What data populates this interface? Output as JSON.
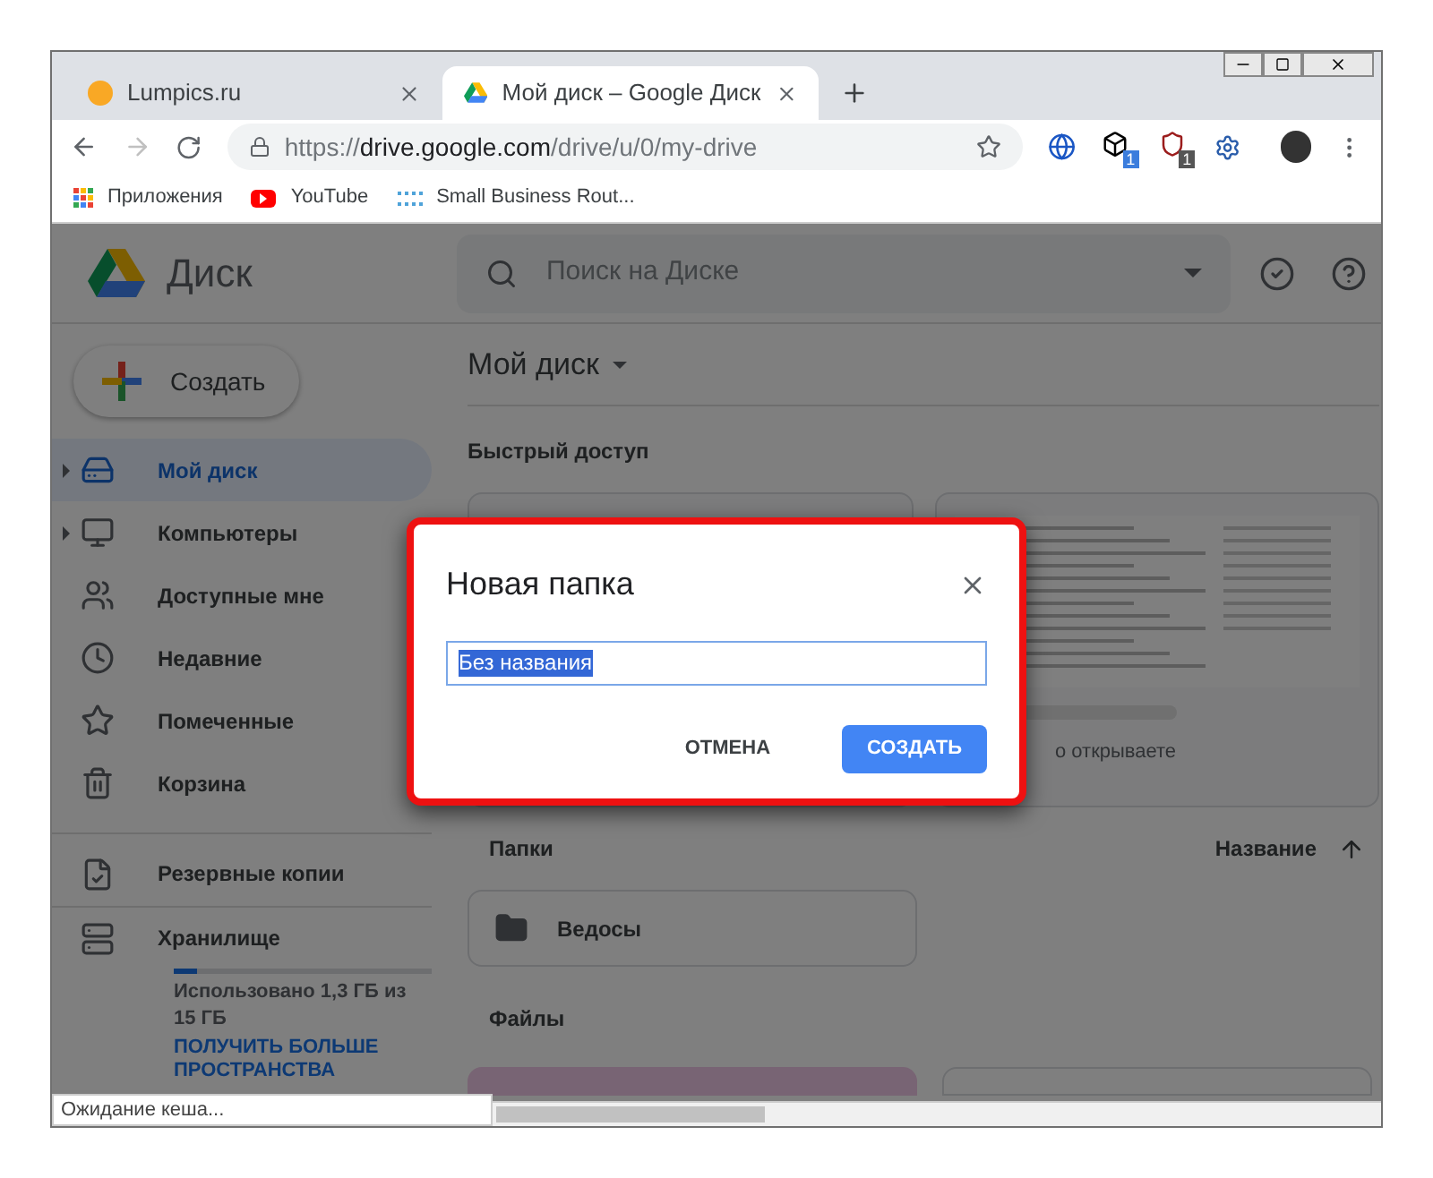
{
  "browser": {
    "tabs": [
      {
        "title": "Lumpics.ru",
        "selected": false
      },
      {
        "title": "Мой диск – Google Диск",
        "selected": true
      }
    ],
    "address": {
      "scheme": "https://",
      "host": "drive.google.com",
      "path": "/drive/u/0/my-drive"
    },
    "extension_badges": [
      "1",
      "1"
    ],
    "bookmarks": [
      "Приложения",
      "YouTube",
      "Small Business Rout..."
    ]
  },
  "drive": {
    "logo": "Диск",
    "search": {
      "placeholder": "Поиск на Диске"
    },
    "create_button": "Создать",
    "nav": [
      {
        "label": "Мой диск",
        "selected": true,
        "expandable": true
      },
      {
        "label": "Компьютеры",
        "selected": false,
        "expandable": true
      },
      {
        "label": "Доступные мне",
        "selected": false,
        "expandable": false
      },
      {
        "label": "Недавние",
        "selected": false,
        "expandable": false
      },
      {
        "label": "Помеченные",
        "selected": false,
        "expandable": false
      },
      {
        "label": "Корзина",
        "selected": false,
        "expandable": false
      }
    ],
    "backups": "Резервные копии",
    "storage": {
      "label": "Хранилище",
      "level": 0.09,
      "usage": "Использовано 1,3 ГБ из 15 ГБ",
      "link": "ПОЛУЧИТЬ БОЛЬШЕ ПРОСТРАНСТВА"
    },
    "main": {
      "title": "Мой диск",
      "quick_access": "Быстрый доступ",
      "quick_caption": "о открываете",
      "folders_heading": "Папки",
      "sort": "Название",
      "folders": [
        {
          "name": "Ведосы"
        }
      ],
      "files_heading": "Файлы"
    }
  },
  "dialog": {
    "title": "Новая папка",
    "value": "Без названия",
    "buttons": [
      {
        "label": "ОТМЕНА",
        "kind": "text"
      },
      {
        "label": "СОЗДАТЬ",
        "kind": "primary"
      }
    ]
  },
  "status_bar": "Ожидание кеша..."
}
